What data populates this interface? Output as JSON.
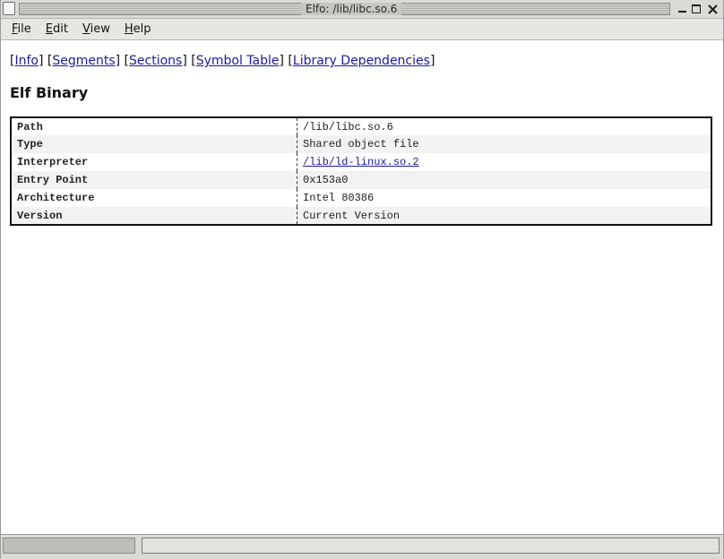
{
  "window": {
    "title": "Elfo: /lib/libc.so.6"
  },
  "menu": {
    "items": [
      {
        "accel": "F",
        "rest": "ile"
      },
      {
        "accel": "E",
        "rest": "dit"
      },
      {
        "accel": "V",
        "rest": "iew"
      },
      {
        "accel": "H",
        "rest": "elp"
      }
    ]
  },
  "nav": {
    "links": [
      "Info",
      "Segments",
      "Sections",
      "Symbol Table",
      "Library Dependencies"
    ]
  },
  "page": {
    "heading": "Elf Binary"
  },
  "table": {
    "rows": [
      {
        "key": "Path",
        "value": "/lib/libc.so.6"
      },
      {
        "key": "Type",
        "value": "Shared object file"
      },
      {
        "key": "Interpreter",
        "value": "/lib/ld-linux.so.2"
      },
      {
        "key": "Entry Point",
        "value": "0x153a0"
      },
      {
        "key": "Architecture",
        "value": "Intel 80386"
      },
      {
        "key": "Version",
        "value": "Current Version"
      }
    ]
  }
}
